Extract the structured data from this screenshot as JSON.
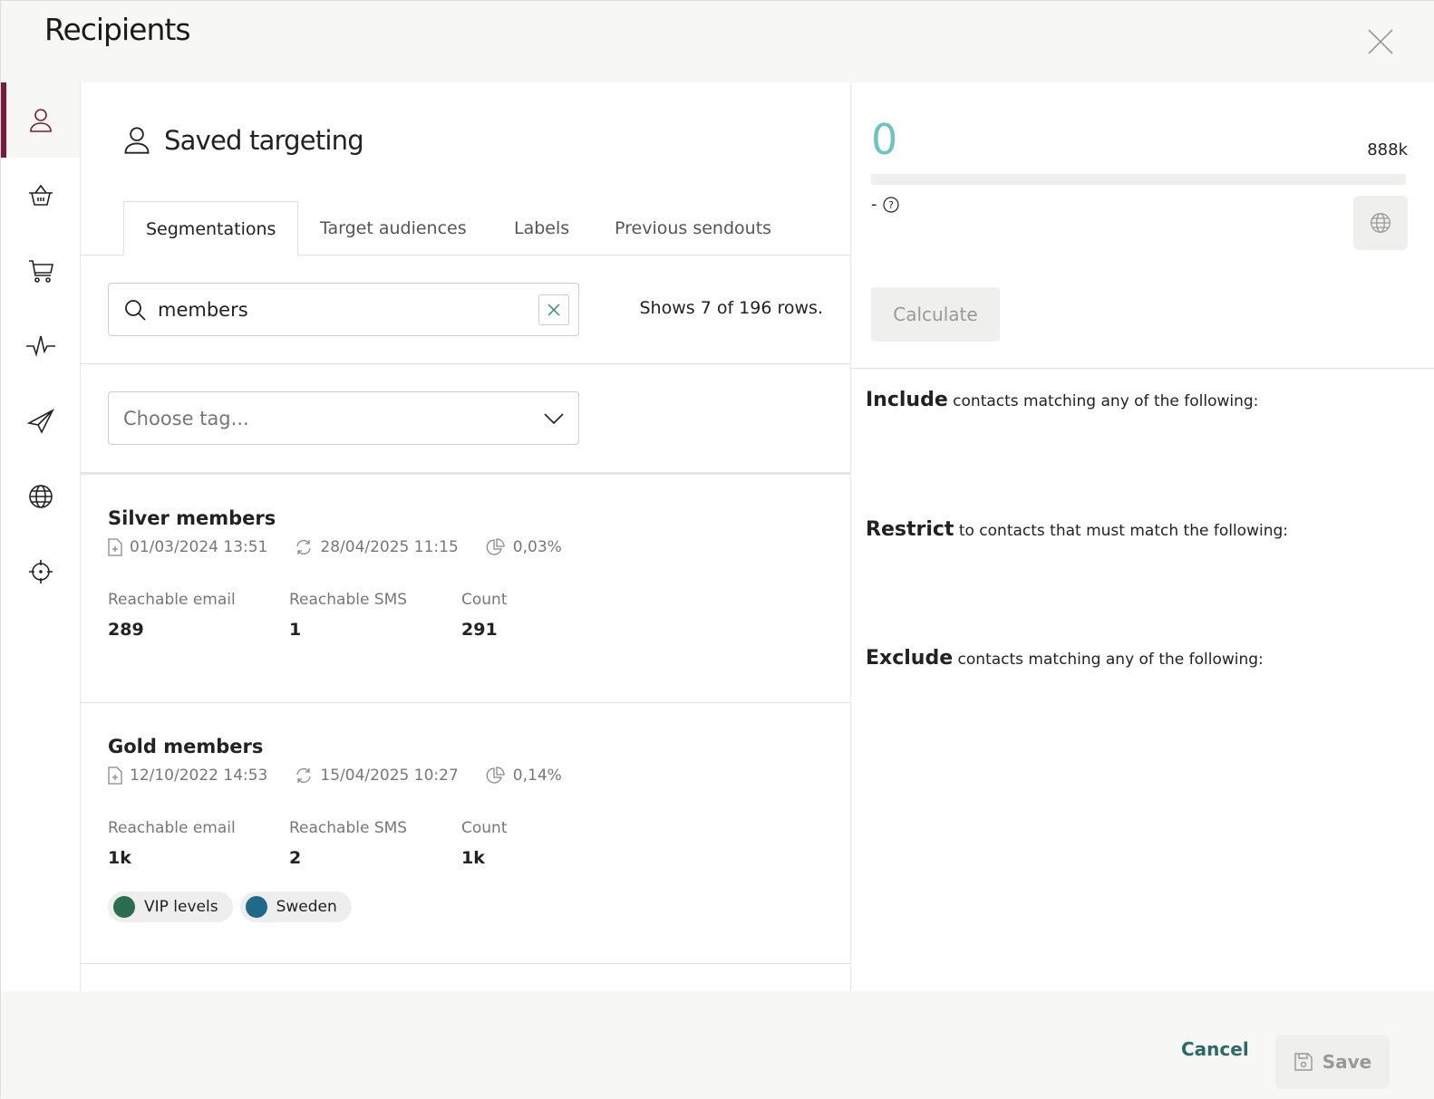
{
  "header": {
    "title": "Recipients"
  },
  "sidebar": {
    "items": [
      {
        "icon": "person-icon",
        "active": true
      },
      {
        "icon": "basket-icon"
      },
      {
        "icon": "cart-icon"
      },
      {
        "icon": "pulse-icon"
      },
      {
        "icon": "paper-plane-icon"
      },
      {
        "icon": "globe-icon"
      },
      {
        "icon": "crosshair-icon"
      }
    ]
  },
  "main": {
    "title": "Saved targeting",
    "tabs": [
      "Segmentations",
      "Target audiences",
      "Labels",
      "Previous sendouts"
    ],
    "search": {
      "value": "members",
      "placeholder": ""
    },
    "row_count": "Shows 7 of 196 rows.",
    "tag_select": {
      "placeholder": "Choose tag..."
    },
    "stat_labels": {
      "email": "Reachable email",
      "sms": "Reachable SMS",
      "count": "Count"
    },
    "segments": [
      {
        "name": "Silver members",
        "created": "01/03/2024 13:51",
        "updated": "28/04/2025 11:15",
        "share": "0,03%",
        "email": "289",
        "sms": "1",
        "count": "291",
        "tags": []
      },
      {
        "name": "Gold members",
        "created": "12/10/2022 14:53",
        "updated": "15/04/2025 10:27",
        "share": "0,14%",
        "email": "1k",
        "sms": "2",
        "count": "1k",
        "tags": [
          {
            "label": "VIP levels",
            "color": "#2a6e4f"
          },
          {
            "label": "Sweden",
            "color": "#1f6a8a"
          }
        ]
      }
    ]
  },
  "summary": {
    "count": "0",
    "max": "888k",
    "progress": 0,
    "dash": "-",
    "calculate": "Calculate",
    "include": {
      "bold": "Include",
      "text": " contacts matching any of the following:"
    },
    "restrict": {
      "bold": "Restrict",
      "text": " to contacts that must match the following:"
    },
    "exclude": {
      "bold": "Exclude",
      "text": " contacts matching any of the following:"
    }
  },
  "footer": {
    "cancel": "Cancel",
    "save": "Save"
  },
  "colors": {
    "accent": "#7a1a3c",
    "teal": "#6cc5c1",
    "cancel": "#2a6b66"
  }
}
